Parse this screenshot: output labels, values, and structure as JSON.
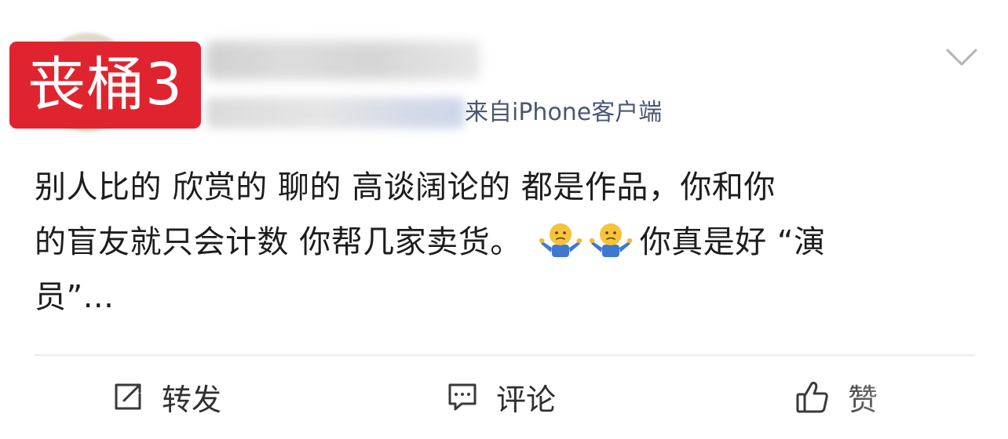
{
  "stamp": {
    "label": "丧桶3"
  },
  "header": {
    "source_client": "来自iPhone客户端"
  },
  "post": {
    "lines": [
      "别人比的 欣赏的 聊的 高谈阔论的 都是作品，你和你",
      "的盲友就只会计数 你帮几家卖货。",
      "你真是好 “演",
      "员”..."
    ],
    "emojis": [
      "shrug-emoji",
      "shrug-emoji"
    ]
  },
  "actions": {
    "repost_label": "转发",
    "comment_label": "评论",
    "like_label": "赞"
  },
  "colors": {
    "stamp_bg": "#e0242f",
    "text": "#1d1d1d",
    "source_client": "#4a5775",
    "divider": "#ececec",
    "action_icon": "#3a3a3a"
  }
}
